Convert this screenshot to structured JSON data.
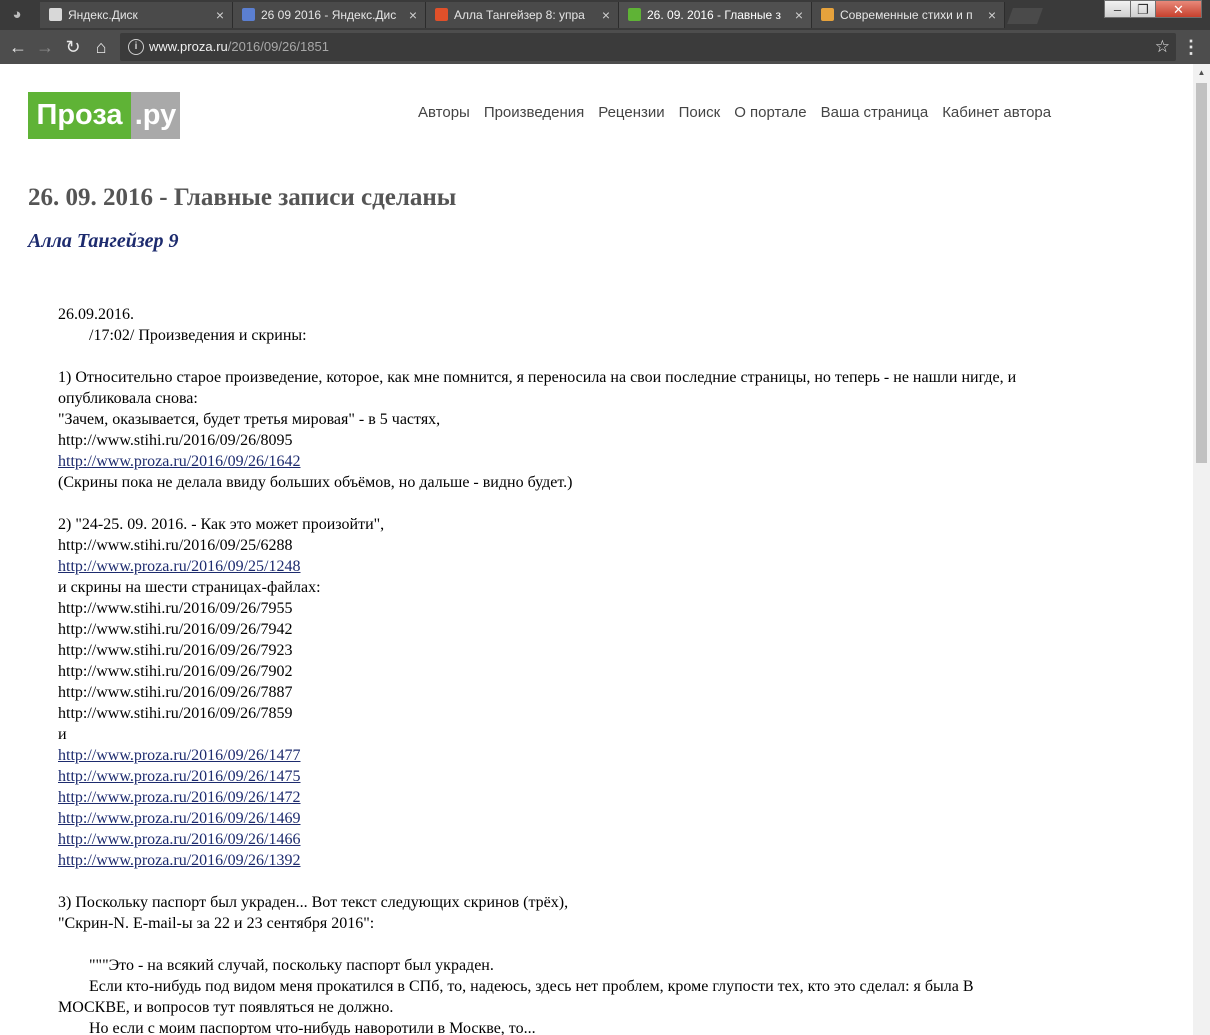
{
  "browser": {
    "tabs": [
      {
        "title": "Яндекс.Диск",
        "favicon_color": "#d8d8d8",
        "active": false
      },
      {
        "title": "26 09 2016 - Яндекс.Дис",
        "favicon_color": "#5b7fd1",
        "active": false
      },
      {
        "title": "Алла Тангейзер 8: упра",
        "favicon_color": "#e0502a",
        "active": false
      },
      {
        "title": "26. 09. 2016 - Главные з",
        "favicon_color": "#5fb336",
        "active": true
      },
      {
        "title": "Современные стихи и п",
        "favicon_color": "#e6a23c",
        "active": false
      }
    ],
    "url_host": "www.proza.ru",
    "url_path": "/2016/09/26/1851"
  },
  "site": {
    "logo_part1": "Проза",
    "logo_part2": ".ру",
    "nav": [
      "Авторы",
      "Произведения",
      "Рецензии",
      "Поиск",
      "О портале",
      "Ваша страница",
      "Кабинет автора"
    ]
  },
  "article": {
    "title": "26. 09. 2016 - Главные записи сделаны",
    "author": "Алла Тангейзер 9",
    "lines": [
      {
        "text": "26.09.2016.",
        "type": "text"
      },
      {
        "text": "/17:02/ Произведения и скрины:",
        "type": "indent"
      },
      {
        "text": "",
        "type": "blank"
      },
      {
        "text": "1) Относительно старое произведение, которое, как мне помнится, я переносила на свои последние страницы, но теперь - не нашли нигде, и опубликовала снова:",
        "type": "wrap"
      },
      {
        "text": "\"Зачем, оказывается, будет третья мировая\" - в 5 частях,",
        "type": "text"
      },
      {
        "text": "http://www.stihi.ru/2016/09/26/8095",
        "type": "text"
      },
      {
        "text": "http://www.proza.ru/2016/09/26/1642 ",
        "type": "link"
      },
      {
        "text": "(Скрины пока не делала ввиду больших объёмов, но дальше - видно будет.)",
        "type": "text"
      },
      {
        "text": "",
        "type": "blank"
      },
      {
        "text": "2) \"24-25. 09. 2016. - Как это может произойти\",",
        "type": "text"
      },
      {
        "text": "http://www.stihi.ru/2016/09/25/6288",
        "type": "text"
      },
      {
        "text": "http://www.proza.ru/2016/09/25/1248 ",
        "type": "link"
      },
      {
        "text": "и скрины на шести страницах-файлах:",
        "type": "text"
      },
      {
        "text": "http://www.stihi.ru/2016/09/26/7955",
        "type": "text"
      },
      {
        "text": "http://www.stihi.ru/2016/09/26/7942",
        "type": "text"
      },
      {
        "text": "http://www.stihi.ru/2016/09/26/7923",
        "type": "text"
      },
      {
        "text": "http://www.stihi.ru/2016/09/26/7902",
        "type": "text"
      },
      {
        "text": "http://www.stihi.ru/2016/09/26/7887",
        "type": "text"
      },
      {
        "text": "http://www.stihi.ru/2016/09/26/7859",
        "type": "text"
      },
      {
        "text": "и",
        "type": "text"
      },
      {
        "text": "http://www.proza.ru/2016/09/26/1477 ",
        "type": "link"
      },
      {
        "text": "http://www.proza.ru/2016/09/26/1475 ",
        "type": "link"
      },
      {
        "text": "http://www.proza.ru/2016/09/26/1472 ",
        "type": "link"
      },
      {
        "text": "http://www.proza.ru/2016/09/26/1469 ",
        "type": "link"
      },
      {
        "text": "http://www.proza.ru/2016/09/26/1466 ",
        "type": "link"
      },
      {
        "text": "http://www.proza.ru/2016/09/26/1392 ",
        "type": "link"
      },
      {
        "text": "",
        "type": "blank"
      },
      {
        "text": "3) Поскольку паспорт был украден... Вот текст следующих скринов (трёх),",
        "type": "text"
      },
      {
        "text": "\"Скрин-N. E-mail-ы за 22 и 23 сентября 2016\":",
        "type": "text"
      },
      {
        "text": "",
        "type": "blank"
      },
      {
        "text": "\"\"\"Это - на всякий случай, поскольку паспорт был украден.",
        "type": "indent"
      },
      {
        "text": "Если кто-нибудь под видом меня прокатился в СПб, то, надеюсь, здесь нет проблем, кроме глупости тех, кто это сделал: я была В МОСКВЕ, и вопросов тут появляться не должно.",
        "type": "indent-wrap"
      },
      {
        "text": "Но если с моим паспортом что-нибудь наворотили в Москве, то...",
        "type": "indent"
      }
    ]
  }
}
